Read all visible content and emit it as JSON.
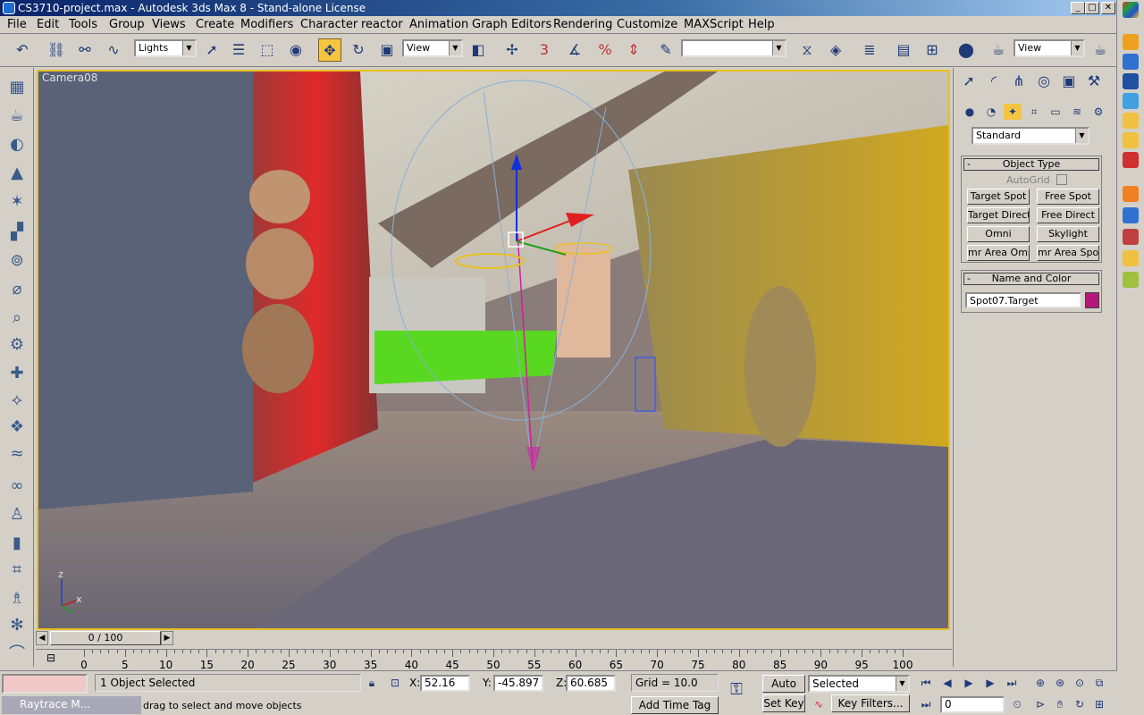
{
  "window": {
    "title": "CS3710-project.max - Autodesk 3ds Max 8  - Stand-alone License",
    "min_label": "_",
    "max_label": "□",
    "close_label": "✕"
  },
  "menu": [
    "File",
    "Edit",
    "Tools",
    "Group",
    "Views",
    "Create",
    "Modifiers",
    "Character",
    "reactor",
    "Animation",
    "Graph Editors",
    "Rendering",
    "Customize",
    "MAXScript",
    "Help"
  ],
  "toolbar": {
    "selection_filter": "Lights",
    "ref_coord": "View",
    "named_sel": "",
    "viewport_mode": "View",
    "snap_angle_label": "3",
    "percent_label": "%"
  },
  "viewport": {
    "label": "Camera08",
    "axis_z": "z",
    "axis_x": "x"
  },
  "command_panel": {
    "category": "Standard",
    "object_type": {
      "title": "Object Type",
      "autogrid_label": "AutoGrid",
      "buttons": [
        "Target Spot",
        "Free Spot",
        "Target Direct",
        "Free Direct",
        "Omni",
        "Skylight",
        "mr Area Omni",
        "mr Area Spot"
      ]
    },
    "name_color": {
      "title": "Name and Color",
      "name_value": "Spot07.Target",
      "color": "#b4187a"
    }
  },
  "timeslider": {
    "label": "0 / 100",
    "ticks": [
      "0",
      "5",
      "10",
      "15",
      "20",
      "25",
      "30",
      "35",
      "40",
      "45",
      "50",
      "55",
      "60",
      "65",
      "70",
      "75",
      "80",
      "85",
      "90",
      "95",
      "100"
    ]
  },
  "status": {
    "selection_info": "1 Object Selected",
    "prompt": "drag to select and move objects",
    "x_label": "X:",
    "x_value": "52.16",
    "y_label": "Y:",
    "y_value": "-45.897",
    "z_label": "Z:",
    "z_value": "60.685",
    "grid": "Grid = 10.0",
    "auto_key": "Auto Key",
    "set_key": "Set Key",
    "key_mode": "Selected",
    "key_filters": "Key Filters...",
    "add_time_tag": "Add Time Tag",
    "frame_value": "0",
    "script_mini": "Raytrace M..."
  },
  "colors": {
    "viewport_border": "#e8c020",
    "accent_active": "#f5c542",
    "title_bar": "#0a246a",
    "light_selected": "#b4187a"
  }
}
